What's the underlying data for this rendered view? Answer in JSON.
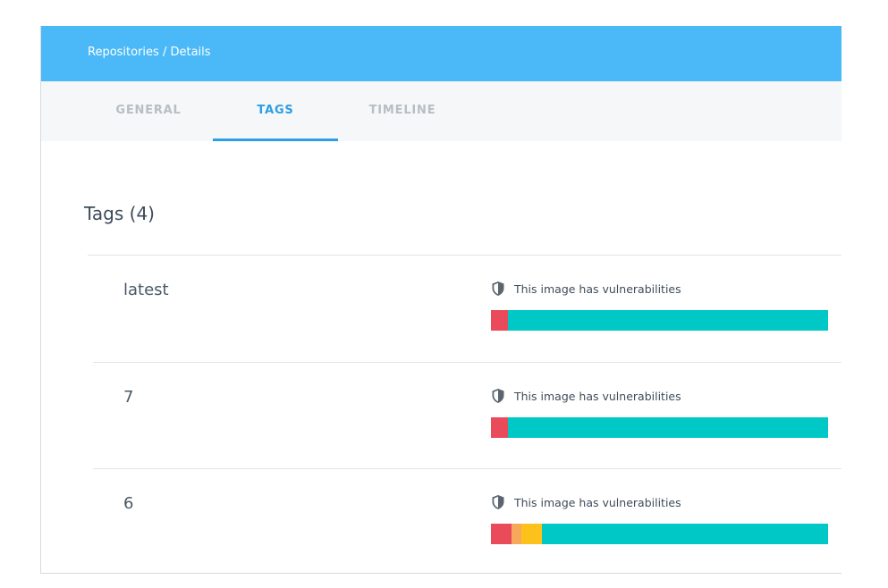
{
  "header": {
    "breadcrumb": "Repositories / Details"
  },
  "tabs": [
    {
      "label": "GENERAL",
      "active": false
    },
    {
      "label": "TAGS",
      "active": true
    },
    {
      "label": "TIMELINE",
      "active": false
    }
  ],
  "tags_section": {
    "title": "Tags (4)",
    "rows": [
      {
        "name": "latest",
        "status_icon": "shield-icon",
        "status_text": "This image has vulnerabilities",
        "severity_fractions": {
          "critical": 0.05,
          "high": 0.0,
          "medium": 0.0,
          "none": 0.95
        }
      },
      {
        "name": "7",
        "status_icon": "shield-icon",
        "status_text": "This image has vulnerabilities",
        "severity_fractions": {
          "critical": 0.05,
          "high": 0.0,
          "medium": 0.0,
          "none": 0.95
        }
      },
      {
        "name": "6",
        "status_icon": "shield-icon",
        "status_text": "This image has vulnerabilities",
        "severity_fractions": {
          "critical": 0.06,
          "high": 0.03,
          "medium": 0.06,
          "none": 0.85
        }
      }
    ]
  },
  "colors": {
    "header_bg": "#4bb9f7",
    "tab_active": "#2c9ee5",
    "tab_inactive": "#b7bec6",
    "critical": "#e94b5a",
    "high": "#f7a85a",
    "medium": "#fdc11c",
    "none": "#00c8c6"
  }
}
